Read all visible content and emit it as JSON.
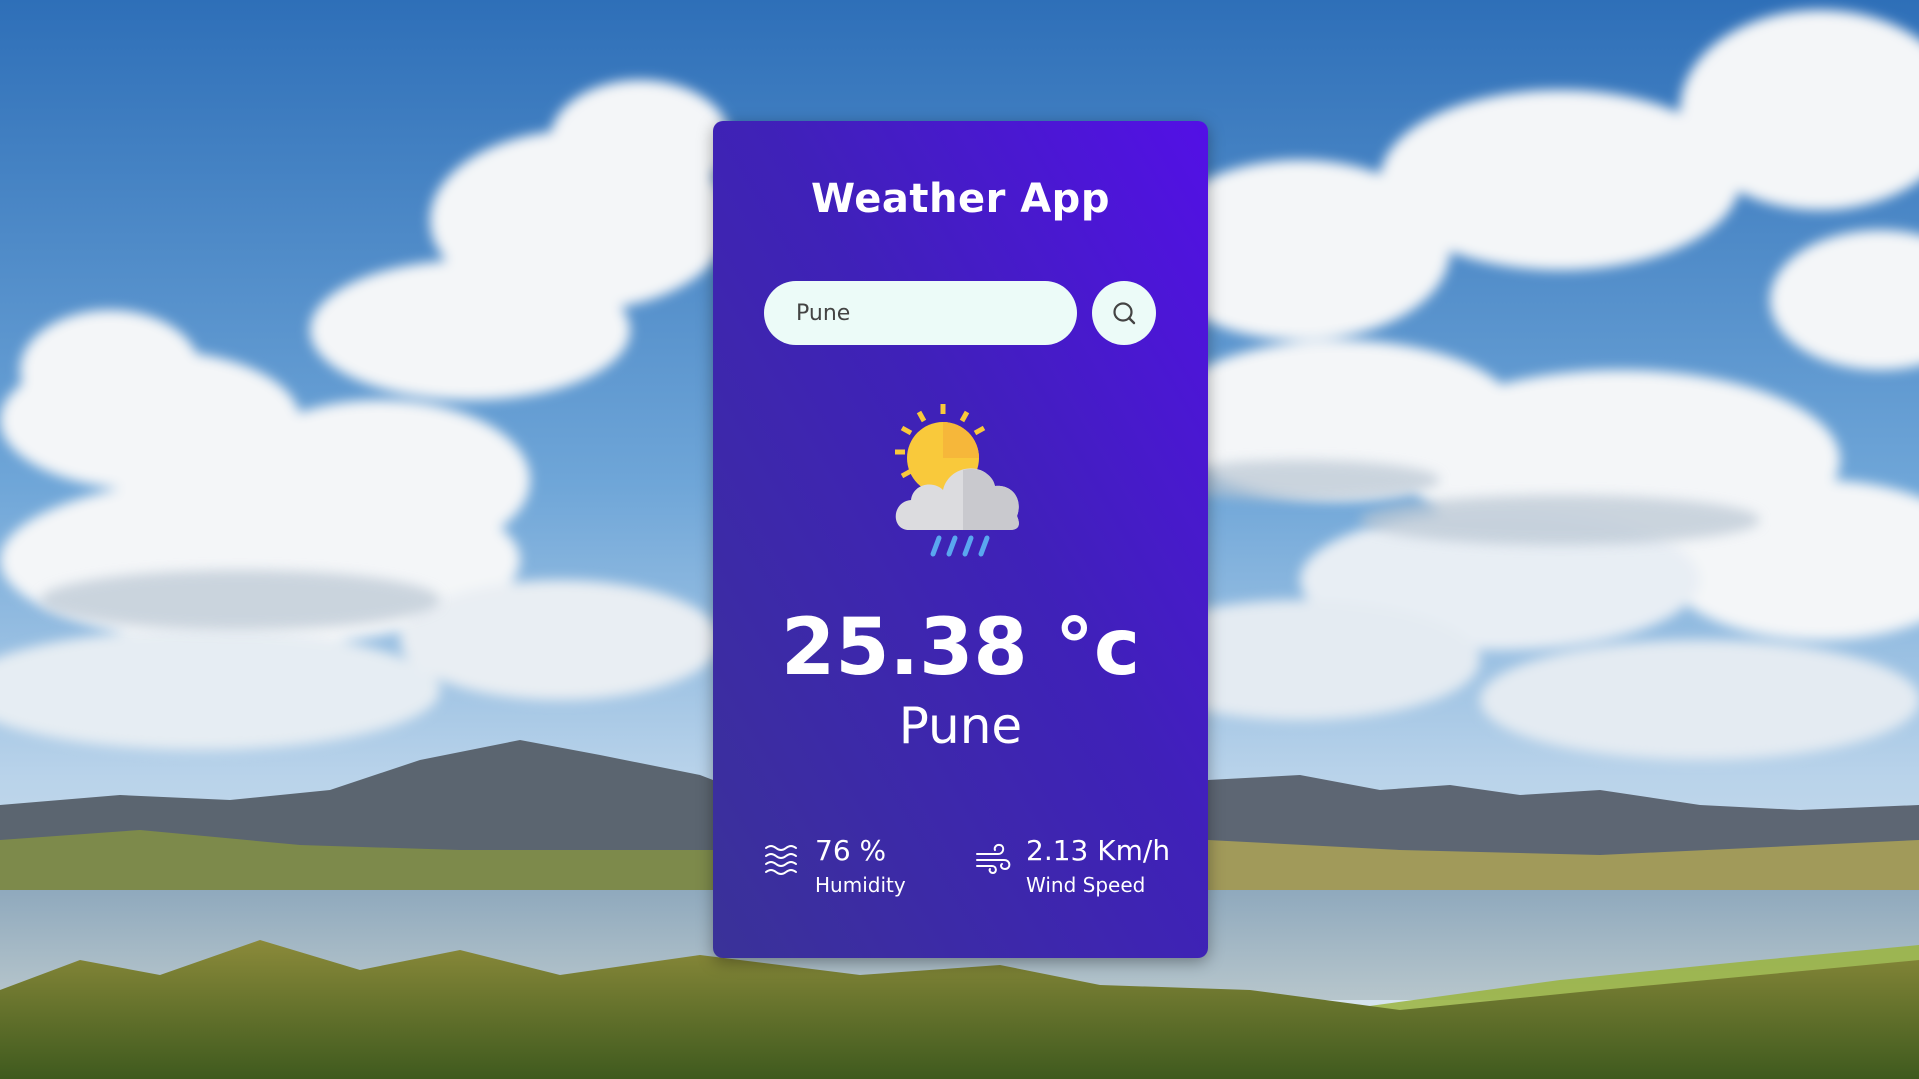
{
  "app": {
    "title": "Weather App"
  },
  "search": {
    "value": "Pune",
    "icon": "search-icon"
  },
  "weather": {
    "icon": "sun-cloud-rain-icon",
    "temperature": "25.38 °c",
    "city": "Pune"
  },
  "details": {
    "humidity": {
      "icon": "humidity-icon",
      "value": "76 %",
      "label": "Humidity"
    },
    "wind": {
      "icon": "wind-icon",
      "value": "2.13 Km/h",
      "label": "Wind Speed"
    }
  },
  "colors": {
    "card_top": "#5310e6",
    "card_bottom": "#3a3298",
    "input_bg": "#ecfbf8",
    "sun": "#f9c93b",
    "cloud": "#dcdcdf",
    "rain": "#5aa7ef"
  }
}
